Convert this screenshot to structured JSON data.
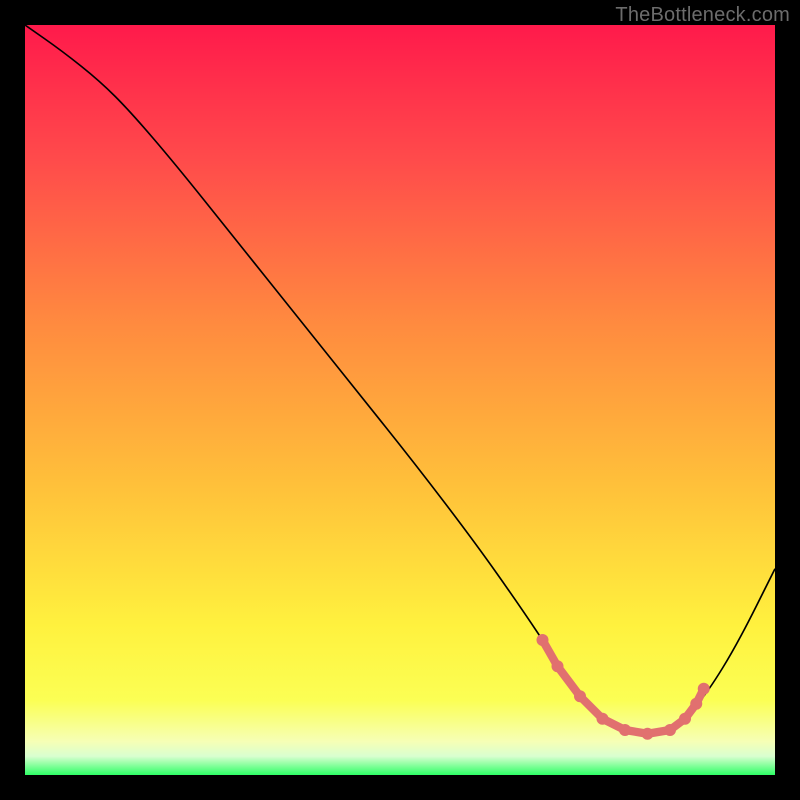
{
  "credit_text": "TheBottleneck.com",
  "palette": {
    "background": "#000000",
    "curve_stroke": "#000000",
    "marker_stroke": "#e1706f",
    "marker_fill": "#e1706f",
    "credit": "#6c6c6c",
    "gradient_stops": [
      {
        "offset": 0.0,
        "color": "#ff1a4b"
      },
      {
        "offset": 0.18,
        "color": "#ff4b4b"
      },
      {
        "offset": 0.4,
        "color": "#ff8b3f"
      },
      {
        "offset": 0.62,
        "color": "#ffc23a"
      },
      {
        "offset": 0.8,
        "color": "#fff13e"
      },
      {
        "offset": 0.9,
        "color": "#fbff54"
      },
      {
        "offset": 0.955,
        "color": "#f6ffb5"
      },
      {
        "offset": 0.975,
        "color": "#d9ffd0"
      },
      {
        "offset": 1.0,
        "color": "#2eff66"
      }
    ]
  },
  "chart_data": {
    "type": "line",
    "x": [
      0.0,
      0.05,
      0.1,
      0.14,
      0.2,
      0.28,
      0.36,
      0.44,
      0.52,
      0.6,
      0.66,
      0.71,
      0.74,
      0.77,
      0.8,
      0.83,
      0.86,
      0.88,
      0.91,
      0.95,
      1.0
    ],
    "series": [
      {
        "name": "bottleneck-curve",
        "values": [
          1.0,
          0.965,
          0.925,
          0.885,
          0.815,
          0.715,
          0.615,
          0.515,
          0.415,
          0.31,
          0.225,
          0.15,
          0.105,
          0.075,
          0.06,
          0.055,
          0.06,
          0.075,
          0.11,
          0.175,
          0.275
        ]
      }
    ],
    "markers": {
      "name": "highlight-range",
      "x": [
        0.69,
        0.71,
        0.74,
        0.77,
        0.8,
        0.83,
        0.86,
        0.88,
        0.895,
        0.905
      ],
      "values": [
        0.18,
        0.145,
        0.105,
        0.075,
        0.06,
        0.055,
        0.06,
        0.075,
        0.095,
        0.115
      ]
    },
    "xlim": [
      0,
      1
    ],
    "ylim": [
      0,
      1
    ],
    "xlabel": "",
    "ylabel": "",
    "title": ""
  }
}
